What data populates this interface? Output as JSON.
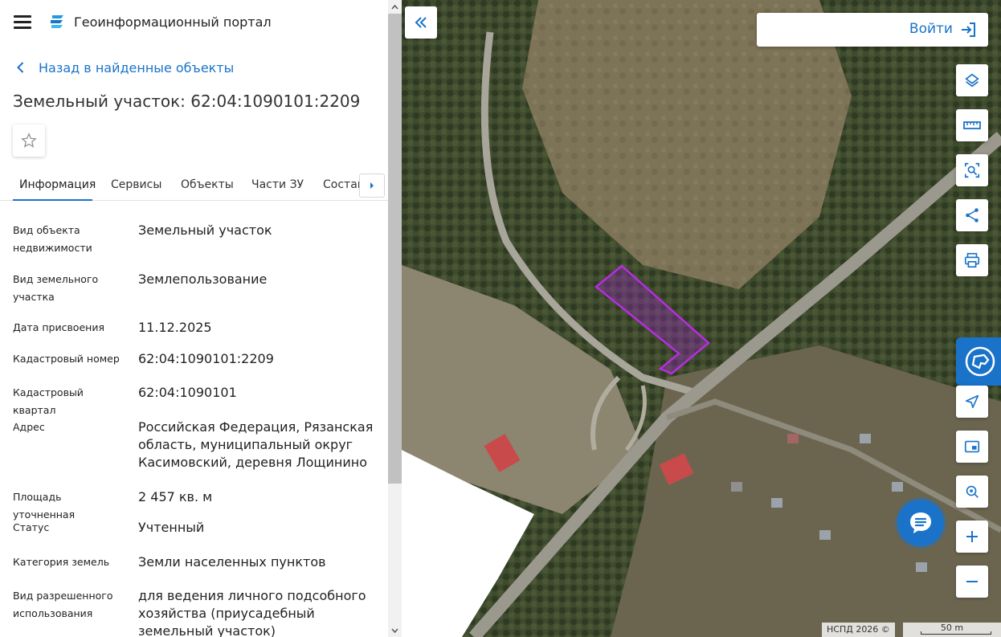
{
  "header": {
    "portal_title": "Геоинформационный портал"
  },
  "back_link": "Назад в найденные объекты",
  "page_title": "Земельный участок: 62:04:1090101:2209",
  "tabs": [
    {
      "label": "Информация",
      "active": true
    },
    {
      "label": "Сервисы",
      "active": false
    },
    {
      "label": "Объекты",
      "active": false
    },
    {
      "label": "Части ЗУ",
      "active": false
    },
    {
      "label": "Состав",
      "active": false
    }
  ],
  "info": [
    {
      "label": "Вид объекта недвижимости",
      "value": "Земельный участок"
    },
    {
      "label": "Вид земельного участка",
      "value": "Землепользование"
    },
    {
      "label": "Дата присвоения",
      "value": "11.12.2025"
    },
    {
      "label": "Кадастровый номер",
      "value": "62:04:1090101:2209"
    },
    {
      "label": "Кадастровый квартал",
      "value": "62:04:1090101"
    },
    {
      "label": "Адрес",
      "value": "Российская Федерация, Рязанская область, муниципальный округ Касимовский, деревня Лощинино"
    },
    {
      "label": "Площадь уточненная",
      "value": "2 457 кв. м"
    },
    {
      "label": "Статус",
      "value": "Учтенный"
    },
    {
      "label": "Категория земель",
      "value": "Земли населенных пунктов"
    },
    {
      "label": "Вид разрешенного использования",
      "value": "для ведения личного подсобного хозяйства (приусадебный земельный участок)"
    }
  ],
  "map": {
    "login_label": "Войти",
    "attribution": "НСПД 2026 ©",
    "scale_label": "50 m",
    "tools": [
      "layers-icon",
      "ruler-icon",
      "select-area-icon",
      "share-icon",
      "print-icon",
      "pkk-icon",
      "locate-icon",
      "minimap-icon",
      "search-location-icon",
      "zoom-in-icon",
      "zoom-out-icon"
    ]
  },
  "colors": {
    "accent": "#1a73c9",
    "parcel": "#9b26c9"
  }
}
